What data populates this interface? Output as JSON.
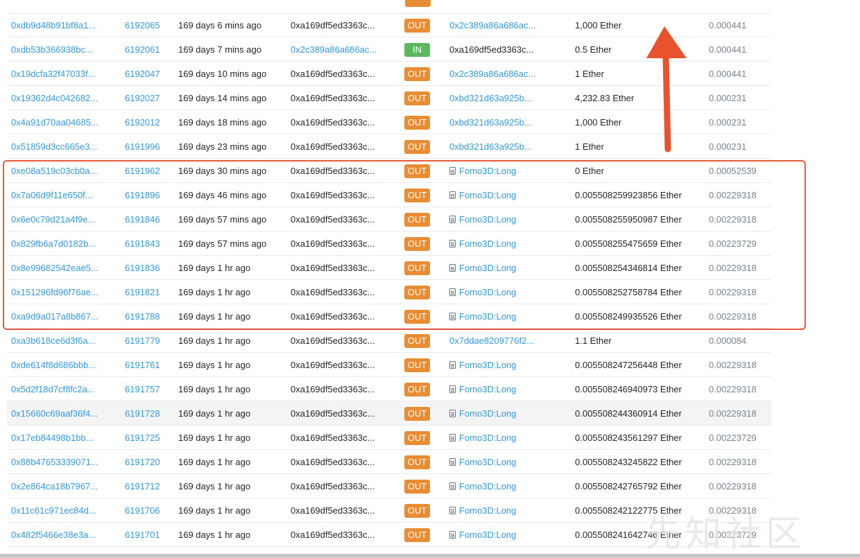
{
  "rows": [
    {
      "hash": "0xdb9d48b91bf8a1...",
      "block": "6192065",
      "age": "169 days 6 mins ago",
      "from": "0xa169df5ed3363c...",
      "dir": "OUT",
      "to": "0x2c389a86a686ac...",
      "to_contract": false,
      "value": "1,000 Ether",
      "fee": "0.000441"
    },
    {
      "hash": "0xdb53b366938bc...",
      "block": "6192061",
      "age": "169 days 7 mins ago",
      "from": "0x2c389a86a686ac...",
      "dir": "IN",
      "to": "0xa169df5ed3363c...",
      "to_contract": false,
      "value": "0.5 Ether",
      "fee": "0.000441"
    },
    {
      "hash": "0x19dcfa32f47033f...",
      "block": "6192047",
      "age": "169 days 10 mins ago",
      "from": "0xa169df5ed3363c...",
      "dir": "OUT",
      "to": "0x2c389a86a686ac...",
      "to_contract": false,
      "value": "1 Ether",
      "fee": "0.000441"
    },
    {
      "hash": "0x19362d4c042682...",
      "block": "6192027",
      "age": "169 days 14 mins ago",
      "from": "0xa169df5ed3363c...",
      "dir": "OUT",
      "to": "0xbd321d63a925b...",
      "to_contract": false,
      "value": "4,232.83 Ether",
      "fee": "0.000231"
    },
    {
      "hash": "0x4a91d70aa04685...",
      "block": "6192012",
      "age": "169 days 18 mins ago",
      "from": "0xa169df5ed3363c...",
      "dir": "OUT",
      "to": "0xbd321d63a925b...",
      "to_contract": false,
      "value": "1,000 Ether",
      "fee": "0.000231"
    },
    {
      "hash": "0x51859d3cc665e3...",
      "block": "6191996",
      "age": "169 days 23 mins ago",
      "from": "0xa169df5ed3363c...",
      "dir": "OUT",
      "to": "0xbd321d63a925b...",
      "to_contract": false,
      "value": "1 Ether",
      "fee": "0.000231"
    },
    {
      "hash": "0xe08a519c03cb0a...",
      "block": "6191962",
      "age": "169 days 30 mins ago",
      "from": "0xa169df5ed3363c...",
      "dir": "OUT",
      "to": "Fomo3D:Long",
      "to_contract": true,
      "value": "0 Ether",
      "fee": "0.00052539"
    },
    {
      "hash": "0x7a06d9f11e650f...",
      "block": "6191896",
      "age": "169 days 46 mins ago",
      "from": "0xa169df5ed3363c...",
      "dir": "OUT",
      "to": "Fomo3D:Long",
      "to_contract": true,
      "value": "0.005508259923856 Ether",
      "fee": "0.00229318"
    },
    {
      "hash": "0x6e0c79d21a4f9e...",
      "block": "6191846",
      "age": "169 days 57 mins ago",
      "from": "0xa169df5ed3363c...",
      "dir": "OUT",
      "to": "Fomo3D:Long",
      "to_contract": true,
      "value": "0.005508255950987 Ether",
      "fee": "0.00229318"
    },
    {
      "hash": "0x829fb6a7d0182b...",
      "block": "6191843",
      "age": "169 days 57 mins ago",
      "from": "0xa169df5ed3363c...",
      "dir": "OUT",
      "to": "Fomo3D:Long",
      "to_contract": true,
      "value": "0.005508255475659 Ether",
      "fee": "0.00223729"
    },
    {
      "hash": "0x8e99682542eae5...",
      "block": "6191836",
      "age": "169 days 1 hr ago",
      "from": "0xa169df5ed3363c...",
      "dir": "OUT",
      "to": "Fomo3D:Long",
      "to_contract": true,
      "value": "0.005508254346814 Ether",
      "fee": "0.00229318"
    },
    {
      "hash": "0x151296fd96f76ae...",
      "block": "6191821",
      "age": "169 days 1 hr ago",
      "from": "0xa169df5ed3363c...",
      "dir": "OUT",
      "to": "Fomo3D:Long",
      "to_contract": true,
      "value": "0.005508252758784 Ether",
      "fee": "0.00229318"
    },
    {
      "hash": "0xa9d9a017a8b867...",
      "block": "6191788",
      "age": "169 days 1 hr ago",
      "from": "0xa169df5ed3363c...",
      "dir": "OUT",
      "to": "Fomo3D:Long",
      "to_contract": true,
      "value": "0.005508249935526 Ether",
      "fee": "0.00229318"
    },
    {
      "hash": "0xa3b618ce6d3f6a...",
      "block": "6191779",
      "age": "169 days 1 hr ago",
      "from": "0xa169df5ed3363c...",
      "dir": "OUT",
      "to": "0x7ddae8209776f2...",
      "to_contract": false,
      "value": "1.1 Ether",
      "fee": "0.000084"
    },
    {
      "hash": "0xde614f8d686bbb...",
      "block": "6191761",
      "age": "169 days 1 hr ago",
      "from": "0xa169df5ed3363c...",
      "dir": "OUT",
      "to": "Fomo3D:Long",
      "to_contract": true,
      "value": "0.005508247256448 Ether",
      "fee": "0.00229318"
    },
    {
      "hash": "0x5d2f18d7cf8fc2a...",
      "block": "6191757",
      "age": "169 days 1 hr ago",
      "from": "0xa169df5ed3363c...",
      "dir": "OUT",
      "to": "Fomo3D:Long",
      "to_contract": true,
      "value": "0.005508246940973 Ether",
      "fee": "0.00229318"
    },
    {
      "hash": "0x15660c69aaf36f4...",
      "block": "6191728",
      "age": "169 days 1 hr ago",
      "from": "0xa169df5ed3363c...",
      "dir": "OUT",
      "to": "Fomo3D:Long",
      "to_contract": true,
      "value": "0.005508244360914 Ether",
      "fee": "0.00229318",
      "shaded": true
    },
    {
      "hash": "0x17eb84498b1bb...",
      "block": "6191725",
      "age": "169 days 1 hr ago",
      "from": "0xa169df5ed3363c...",
      "dir": "OUT",
      "to": "Fomo3D:Long",
      "to_contract": true,
      "value": "0.005508243561297 Ether",
      "fee": "0.00223729"
    },
    {
      "hash": "0x88b47653339071...",
      "block": "6191720",
      "age": "169 days 1 hr ago",
      "from": "0xa169df5ed3363c...",
      "dir": "OUT",
      "to": "Fomo3D:Long",
      "to_contract": true,
      "value": "0.005508243245822 Ether",
      "fee": "0.00229318"
    },
    {
      "hash": "0x2e864ca18b7967...",
      "block": "6191712",
      "age": "169 days 1 hr ago",
      "from": "0xa169df5ed3363c...",
      "dir": "OUT",
      "to": "Fomo3D:Long",
      "to_contract": true,
      "value": "0.005508242765792 Ether",
      "fee": "0.00229318"
    },
    {
      "hash": "0x11c61c971ec84d...",
      "block": "6191706",
      "age": "169 days 1 hr ago",
      "from": "0xa169df5ed3363c...",
      "dir": "OUT",
      "to": "Fomo3D:Long",
      "to_contract": true,
      "value": "0.005508242122775 Ether",
      "fee": "0.00229318"
    },
    {
      "hash": "0x482f5466e38e3a...",
      "block": "6191701",
      "age": "169 days 1 hr ago",
      "from": "0xa169df5ed3363c...",
      "dir": "OUT",
      "to": "Fomo3D:Long",
      "to_contract": true,
      "value": "0.005508241642746 Ether",
      "fee": "0.00223729"
    }
  ],
  "icons": {
    "contract": "document-icon",
    "annotation": "up-arrow-icon"
  },
  "colors": {
    "link": "#3498db",
    "out_badge": "#e98d35",
    "in_badge": "#5cb85c",
    "highlight": "#e45a3b"
  },
  "watermark": "先知社区"
}
